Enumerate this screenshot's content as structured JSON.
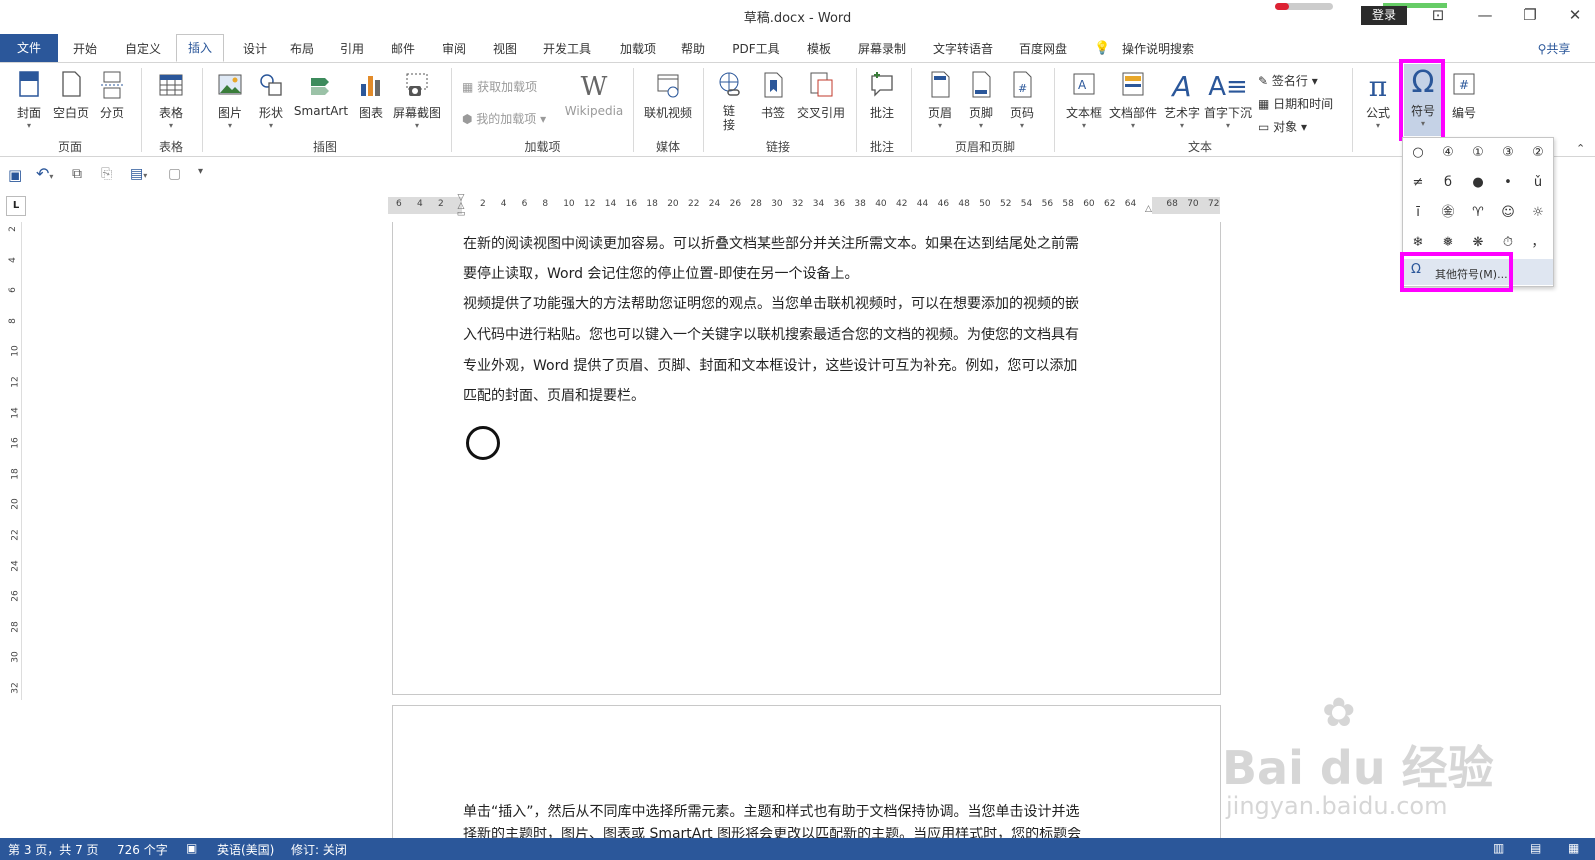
{
  "window": {
    "title": "草稿.docx  -  Word",
    "login": "登录",
    "minimize": "—",
    "restore": "❐",
    "close": "✕"
  },
  "tabs": [
    {
      "label": "文件"
    },
    {
      "label": "开始"
    },
    {
      "label": "自定义"
    },
    {
      "label": "插入"
    },
    {
      "label": "设计"
    },
    {
      "label": "布局"
    },
    {
      "label": "引用"
    },
    {
      "label": "邮件"
    },
    {
      "label": "审阅"
    },
    {
      "label": "视图"
    },
    {
      "label": "开发工具"
    },
    {
      "label": "加载项"
    },
    {
      "label": "帮助"
    },
    {
      "label": "PDF工具"
    },
    {
      "label": "模板"
    },
    {
      "label": "屏幕录制"
    },
    {
      "label": "文字转语音"
    },
    {
      "label": "百度网盘"
    },
    {
      "label": "操作说明搜索"
    },
    {
      "label": "共享"
    }
  ],
  "ribbon": {
    "pages": {
      "cover": "封面",
      "blank": "空白页",
      "break": "分页",
      "group": "页面"
    },
    "table": {
      "table": "表格",
      "group": "表格"
    },
    "illustrations": {
      "picture": "图片",
      "shape": "形状",
      "smartart": "SmartArt",
      "chart": "图表",
      "screenshot": "屏幕截图",
      "group": "插图"
    },
    "addins": {
      "get": "获取加载项",
      "mine": "我的加载项",
      "wikipedia": "Wikipedia",
      "group": "加载项"
    },
    "media": {
      "video": "联机视频",
      "group": "媒体"
    },
    "links": {
      "link": "链接",
      "bookmark": "书签",
      "crossref": "交叉引用",
      "group": "链接"
    },
    "comments": {
      "comment": "批注",
      "group": "批注"
    },
    "headerfooter": {
      "header": "页眉",
      "footer": "页脚",
      "pagenum": "页码",
      "group": "页眉和页脚"
    },
    "text": {
      "textbox": "文本框",
      "parts": "文档部件",
      "wordart": "艺术字",
      "dropcap": "首字下沉",
      "signature": "签名行",
      "datetime": "日期和时间",
      "object": "对象",
      "group": "文本"
    },
    "symbols": {
      "equation": "公式",
      "symbol": "符号",
      "number": "编号"
    }
  },
  "document": {
    "paragraphs": [
      "在新的阅读视图中阅读更加容易。可以折叠文档某些部分并关注所需文本。如果在达到结尾处之前需",
      "要停止读取，Word 会记住您的停止位置-即使在另一个设备上。",
      "视频提供了功能强大的方法帮助您证明您的观点。当您单击联机视频时，可以在想要添加的视频的嵌",
      "入代码中进行粘贴。您也可以键入一个关键字以联机搜索最适合您的文档的视频。为使您的文档具有",
      "专业外观，Word 提供了页眉、页脚、封面和文本框设计，这些设计可互为补充。例如，您可以添加",
      "匹配的封面、页眉和提要栏。"
    ],
    "page2_paragraphs": [
      "单击“插入”，然后从不同库中选择所需元素。主题和样式也有助于文档保持协调。当您单击设计并选",
      "择新的主题时，图片、图表或 SmartArt 图形将会更改以匹配新的主题。当应用样式时，您的标题会"
    ]
  },
  "ruler": {
    "h_left": [
      "6",
      "4",
      "2"
    ],
    "h_right": [
      "2",
      "4",
      "6",
      "8",
      "10",
      "12",
      "14",
      "16",
      "18",
      "20",
      "22",
      "24",
      "26",
      "28",
      "30",
      "32",
      "34",
      "36",
      "38",
      "40",
      "42",
      "44",
      "46",
      "48",
      "50",
      "52",
      "54",
      "56",
      "58",
      "60",
      "62",
      "64",
      "68",
      "70",
      "72"
    ],
    "v": [
      "2",
      "4",
      "6",
      "8",
      "10",
      "12",
      "14",
      "16",
      "18",
      "20",
      "22",
      "24",
      "26",
      "28",
      "30",
      "32"
    ],
    "corner": "L"
  },
  "symbols_dropdown": {
    "grid": [
      "○",
      "④",
      "①",
      "③",
      "②",
      "≠",
      "б",
      "●",
      "•",
      "ǔ",
      "ī",
      "㊎",
      "♈",
      "☺",
      "☼",
      "❄",
      "❅",
      "❋",
      "⏱",
      "，"
    ],
    "more": "其他符号(M)..."
  },
  "statusbar": {
    "page": "第 3 页，共 7 页",
    "words": "726 个字",
    "language": "英语(美国)",
    "track": "修订: 关闭"
  },
  "watermark": {
    "brand": "Bai du 经验",
    "url": "jingyan.baidu.com"
  },
  "colors": {
    "accent": "#2b579a",
    "highlight": "#ff00ff"
  }
}
